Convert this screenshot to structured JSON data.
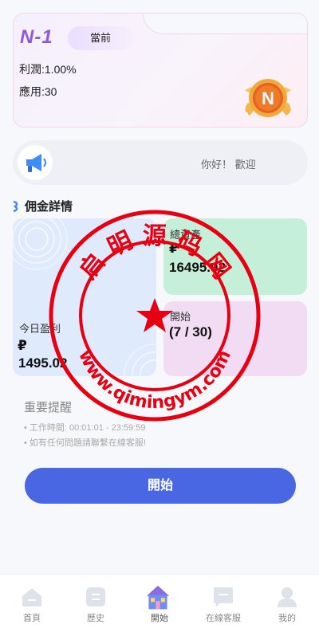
{
  "level": {
    "name": "N-1",
    "badge": "當前",
    "profit": "利潤:1.00%",
    "usage": "應用:30",
    "medal_letter": "N"
  },
  "notice": {
    "message": "你好！ 歡迎"
  },
  "commission": {
    "title": "佣金詳情",
    "today_label": "今日盈利",
    "today_symbol": "₽",
    "today_value": "1495.02",
    "total_label": "總資產",
    "total_symbol": "₽",
    "total_value": "16495.02",
    "start_label": "開始",
    "start_progress": "(7 / 30)"
  },
  "reminder": {
    "title": "重要提醒",
    "line1": "• 工作時間: 00:01:01 - 23:59:59",
    "line2": "• 如有任何問題請聯繫在線客服!"
  },
  "start_button": "開始",
  "watermark": {
    "top_text": "启 明 源 码 网",
    "bottom_text": "www.qimingym.com",
    "color": "#e60012"
  },
  "tabs": [
    {
      "label": "首頁",
      "icon": "home-icon"
    },
    {
      "label": "歷史",
      "icon": "history-icon"
    },
    {
      "label": "開始",
      "icon": "start-icon"
    },
    {
      "label": "在線客服",
      "icon": "support-icon"
    },
    {
      "label": "我的",
      "icon": "profile-icon"
    }
  ],
  "colors": {
    "accent": "#4a67e3",
    "level_name": "#8f5ad9",
    "tile_blue": "#dfeafc",
    "tile_green": "#c6efd9",
    "tile_pink": "#f2dcf3"
  }
}
